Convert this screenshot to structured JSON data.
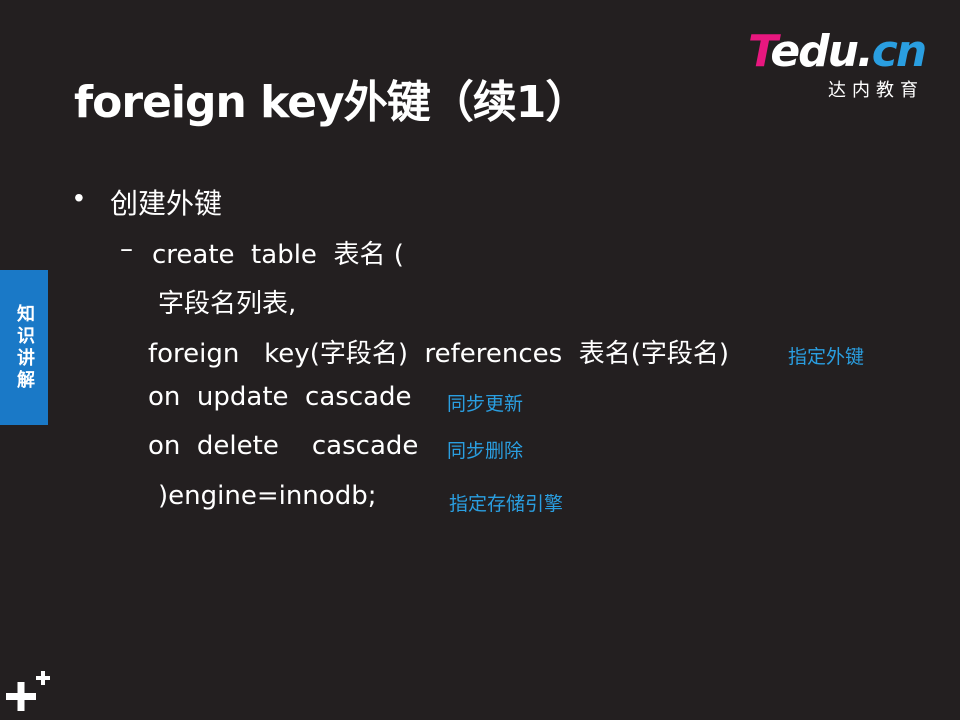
{
  "slide": {
    "title": "foreign key外键（续1）",
    "logo": {
      "main_t": "T",
      "main_rest": "edu.",
      "main_cn": "cn",
      "subtitle": "达内教育"
    },
    "side_tab": "知识讲解",
    "bullet": {
      "symbol": "•",
      "text": "创建外键"
    },
    "code": {
      "dash": "–",
      "line1": "create  table  表名 (",
      "line2": "字段名列表,",
      "line3": "foreign   key(字段名)  references  表名(字段名)",
      "line4": "on  update  cascade",
      "line5": "on  delete    cascade",
      "line6": ")engine=innodb;"
    },
    "notes": {
      "foreign_key": "指定外键",
      "update": "同步更新",
      "delete": "同步删除",
      "engine": "指定存储引擎"
    },
    "colors": {
      "background": "#231f20",
      "accent_blue": "#2a9ee0",
      "tab_blue": "#1a79c7",
      "logo_pink": "#e8177f"
    },
    "icons": {
      "corner": "plus-icon"
    }
  }
}
